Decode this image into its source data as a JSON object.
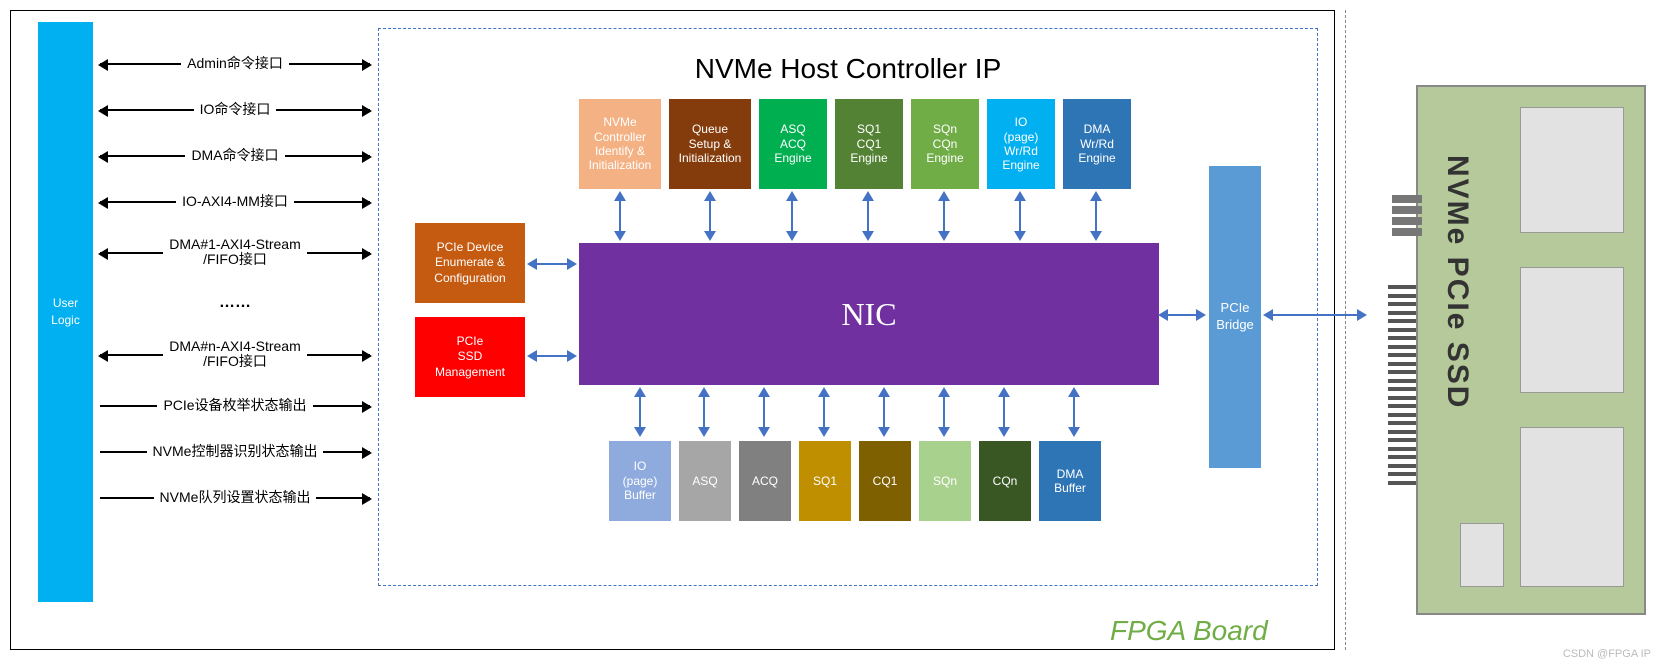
{
  "user_logic": "User\nLogic",
  "interfaces": [
    "Admin命令接口",
    "IO命令接口",
    "DMA命令接口",
    "IO-AXI4-MM接口",
    "DMA#1-AXI4-Stream\n/FIFO接口",
    "……",
    "DMA#n-AXI4-Stream\n/FIFO接口",
    "PCIe设备枚举状态输出",
    "NVMe控制器识别状态输出",
    "NVMe队列设置状态输出"
  ],
  "ip_title": "NVMe Host Controller IP",
  "top_blocks": [
    {
      "label": "NVMe\nController\nIdentify &\nInitialization",
      "color": "#ed7d31"
    },
    {
      "label": "Queue\nSetup &\nInitialization",
      "color": "#843c0c"
    },
    {
      "label": "ASQ\nACQ\nEngine",
      "color": "#00b050"
    },
    {
      "label": "SQ1\nCQ1\nEngine",
      "color": "#548235"
    },
    {
      "label": "SQn\nCQn\nEngine",
      "color": "#70ad47"
    },
    {
      "label": "IO\n(page)\nWr/Rd\nEngine",
      "color": "#00b0f0"
    },
    {
      "label": "DMA\nWr/Rd\nEngine",
      "color": "#2e75b6"
    }
  ],
  "nic": "NIC",
  "left_blocks": [
    {
      "label": "PCIe Device\nEnumerate &\nConfiguration",
      "color": "#c55a11"
    },
    {
      "label": "PCIe\nSSD\nManagement",
      "color": "#ff0000"
    }
  ],
  "bottom_blocks": [
    {
      "label": "IO\n(page)\nBuffer",
      "color": "#8faadc"
    },
    {
      "label": "ASQ",
      "color": "#a6a6a6"
    },
    {
      "label": "ACQ",
      "color": "#808080"
    },
    {
      "label": "SQ1",
      "color": "#bf8f00"
    },
    {
      "label": "CQ1",
      "color": "#7f6000"
    },
    {
      "label": "SQn",
      "color": "#a9d18e"
    },
    {
      "label": "CQn",
      "color": "#385723"
    },
    {
      "label": "DMA\nBuffer",
      "color": "#2e75b6"
    }
  ],
  "pcie_bridge": "PCIe\nBridge",
  "fpga_board": "FPGA Board",
  "ssd_label": "NVMe PCIe SSD",
  "watermark": "CSDN @FPGA IP"
}
